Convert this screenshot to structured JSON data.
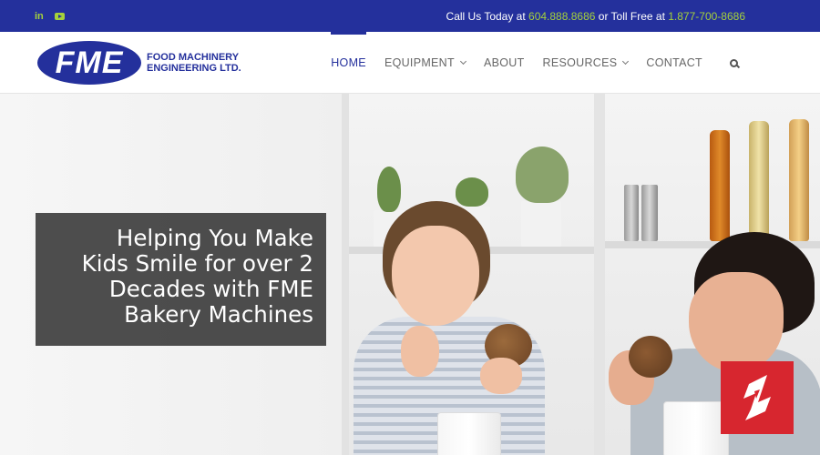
{
  "topbar": {
    "social": [
      {
        "name": "linkedin",
        "glyph": "in"
      },
      {
        "name": "youtube",
        "glyph": ""
      }
    ],
    "call_prefix": "Call Us Today at ",
    "phone_local": "604.888.8686",
    "toll_prefix": " or Toll Free at ",
    "phone_toll_free": "1.877-700-8686"
  },
  "logo": {
    "mark": "FME",
    "line1": "FOOD MACHINERY",
    "line2": "ENGINEERING LTD."
  },
  "nav": {
    "items": [
      {
        "label": "HOME",
        "active": true,
        "dropdown": false
      },
      {
        "label": "EQUIPMENT",
        "active": false,
        "dropdown": true
      },
      {
        "label": "ABOUT",
        "active": false,
        "dropdown": false
      },
      {
        "label": "RESOURCES",
        "active": false,
        "dropdown": true
      },
      {
        "label": "CONTACT",
        "active": false,
        "dropdown": false
      }
    ],
    "search_icon": "search-icon"
  },
  "hero": {
    "headline_lines": [
      "Helping You Make",
      "Kids Smile for over 2",
      "Decades with FME",
      "Bakery Machines"
    ],
    "badge_icon": "brand-badge-icon"
  },
  "colors": {
    "brand_blue": "#24309c",
    "accent_green": "#a5d13b",
    "badge_red": "#d7262f"
  }
}
